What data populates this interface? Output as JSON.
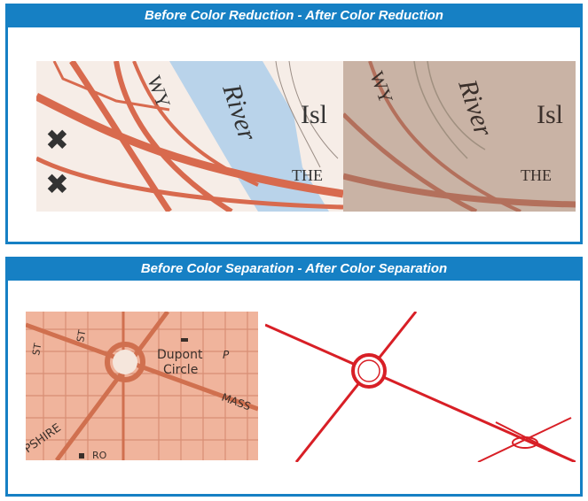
{
  "panels": {
    "reduction": {
      "title": "Before Color Reduction - After Color Reduction",
      "map_labels": {
        "river": "River",
        "isl": "Isl",
        "wy": "WY",
        "the": "THE"
      }
    },
    "separation": {
      "title": "Before Color Separation - After Color Separation",
      "map_labels": {
        "dupont": "Dupont",
        "circle": "Circle",
        "st": "ST",
        "st2": "ST",
        "p": "P",
        "mass": "MASS",
        "pshire": "PSHIRE",
        "ro": "RO"
      }
    }
  },
  "colors": {
    "frame_blue": "#1680c4",
    "road_red": "#d86a4e",
    "river_blue": "#b9d3ea",
    "tan_background": "#c9b3a5",
    "map_salmon": "#f0b49c",
    "separation_line_red": "#d81f26"
  }
}
